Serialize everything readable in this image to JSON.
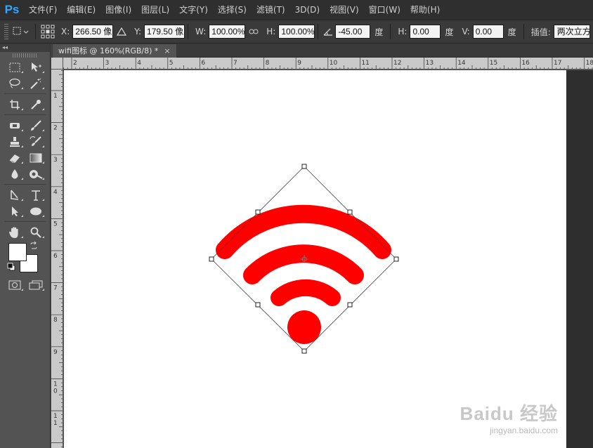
{
  "app": {
    "logo": "Ps"
  },
  "menu": [
    "文件(F)",
    "编辑(E)",
    "图像(I)",
    "图层(L)",
    "文字(Y)",
    "选择(S)",
    "滤镜(T)",
    "3D(D)",
    "视图(V)",
    "窗口(W)",
    "帮助(H)"
  ],
  "options": {
    "x_label": "X:",
    "x_value": "266.50 像",
    "y_label": "Y:",
    "y_value": "179.50 像",
    "w_label": "W:",
    "w_value": "100.00%",
    "h_label": "H:",
    "h_value": "100.00%",
    "angle_value": "-45.00",
    "angle_unit": "度",
    "hskew_label": "H:",
    "hskew_value": "0.00",
    "hskew_unit": "度",
    "vskew_label": "V:",
    "vskew_value": "0.00",
    "vskew_unit": "度",
    "interp_label": "插值:",
    "interp_value": "两次立方"
  },
  "toolbar": {
    "collapse": "◂◂"
  },
  "document": {
    "tab_title": "wifi图标 @ 160%(RGB/8) *",
    "close": "×"
  },
  "ruler": {
    "h_ticks": [
      "2",
      "3",
      "4",
      "5",
      "6",
      "7",
      "8",
      "9",
      "10",
      "11",
      "12",
      "13",
      "14",
      "15",
      "16",
      "17",
      "18"
    ],
    "v_ticks": [
      "1",
      "2",
      "3",
      "4",
      "5",
      "6",
      "7",
      "8",
      "9",
      "10",
      "11"
    ]
  },
  "colors": {
    "wifi": "#ff0000",
    "canvas": "#ffffff",
    "accent": "#31a8ff"
  },
  "watermark": {
    "main": "Baidu 经验",
    "sub": "jingyan.baidu.com"
  }
}
